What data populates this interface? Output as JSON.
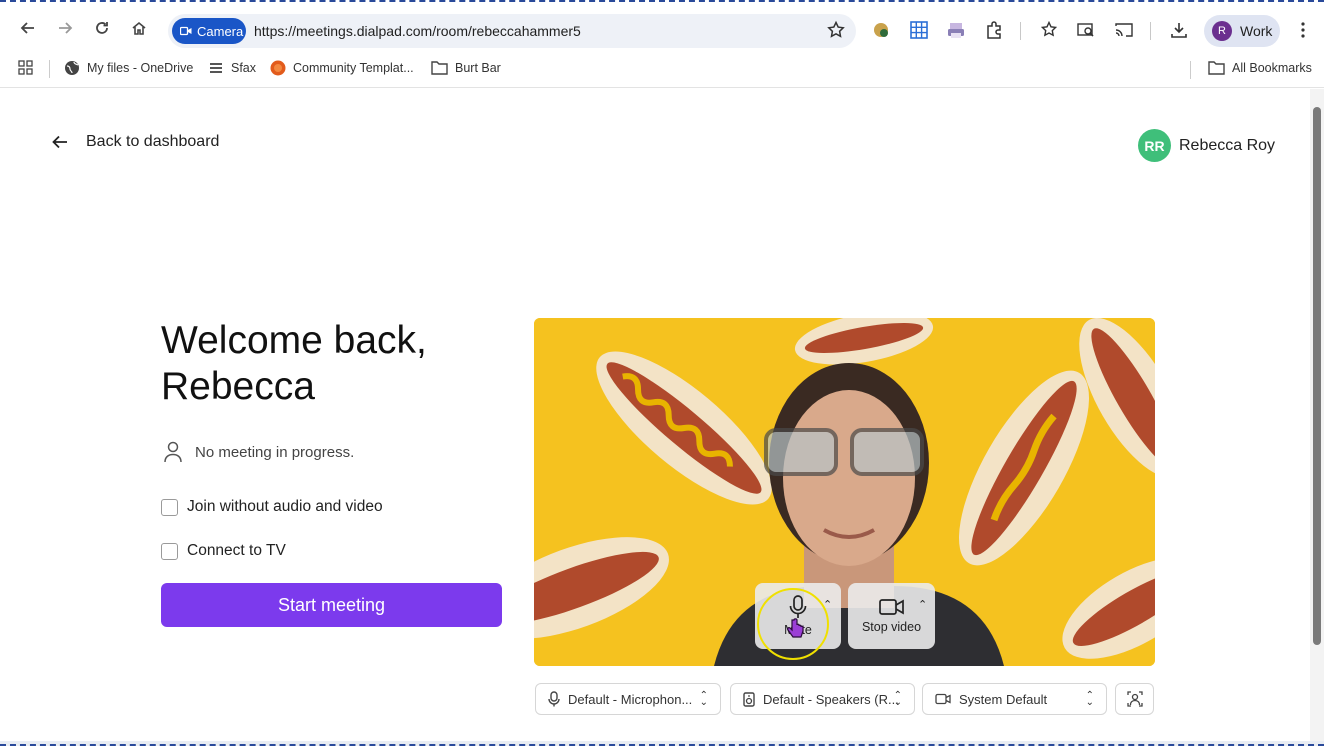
{
  "browser": {
    "chip_label": "Camera",
    "url": "https://meetings.dialpad.com/room/rebeccahammer5",
    "profile_initial": "R",
    "profile_label": "Work"
  },
  "bookmarks": [
    {
      "label": "My files - OneDrive"
    },
    {
      "label": "Sfax"
    },
    {
      "label": "Community Templat..."
    },
    {
      "label": "Burt Bar"
    }
  ],
  "all_bookmarks": "All Bookmarks",
  "header": {
    "back_label": "Back to dashboard",
    "user_initials": "RR",
    "user_name": "Rebecca Roy"
  },
  "main": {
    "welcome_line1": "Welcome back,",
    "welcome_line2": "Rebecca",
    "status_text": "No meeting in progress.",
    "options": [
      {
        "label": "Join without audio and video",
        "checked": false
      },
      {
        "label": "Connect to TV",
        "checked": false
      }
    ],
    "start_label": "Start meeting"
  },
  "video_controls": {
    "mute_label": "Mute",
    "stop_video_label": "Stop video"
  },
  "devices": {
    "microphone": "Default - Microphon...",
    "speakers": "Default - Speakers (R...",
    "camera": "System Default"
  },
  "colors": {
    "accent": "#7c3aed",
    "video_bg": "#f5c21f",
    "avatar": "#3fbf7a",
    "chip": "#1a56c7"
  }
}
